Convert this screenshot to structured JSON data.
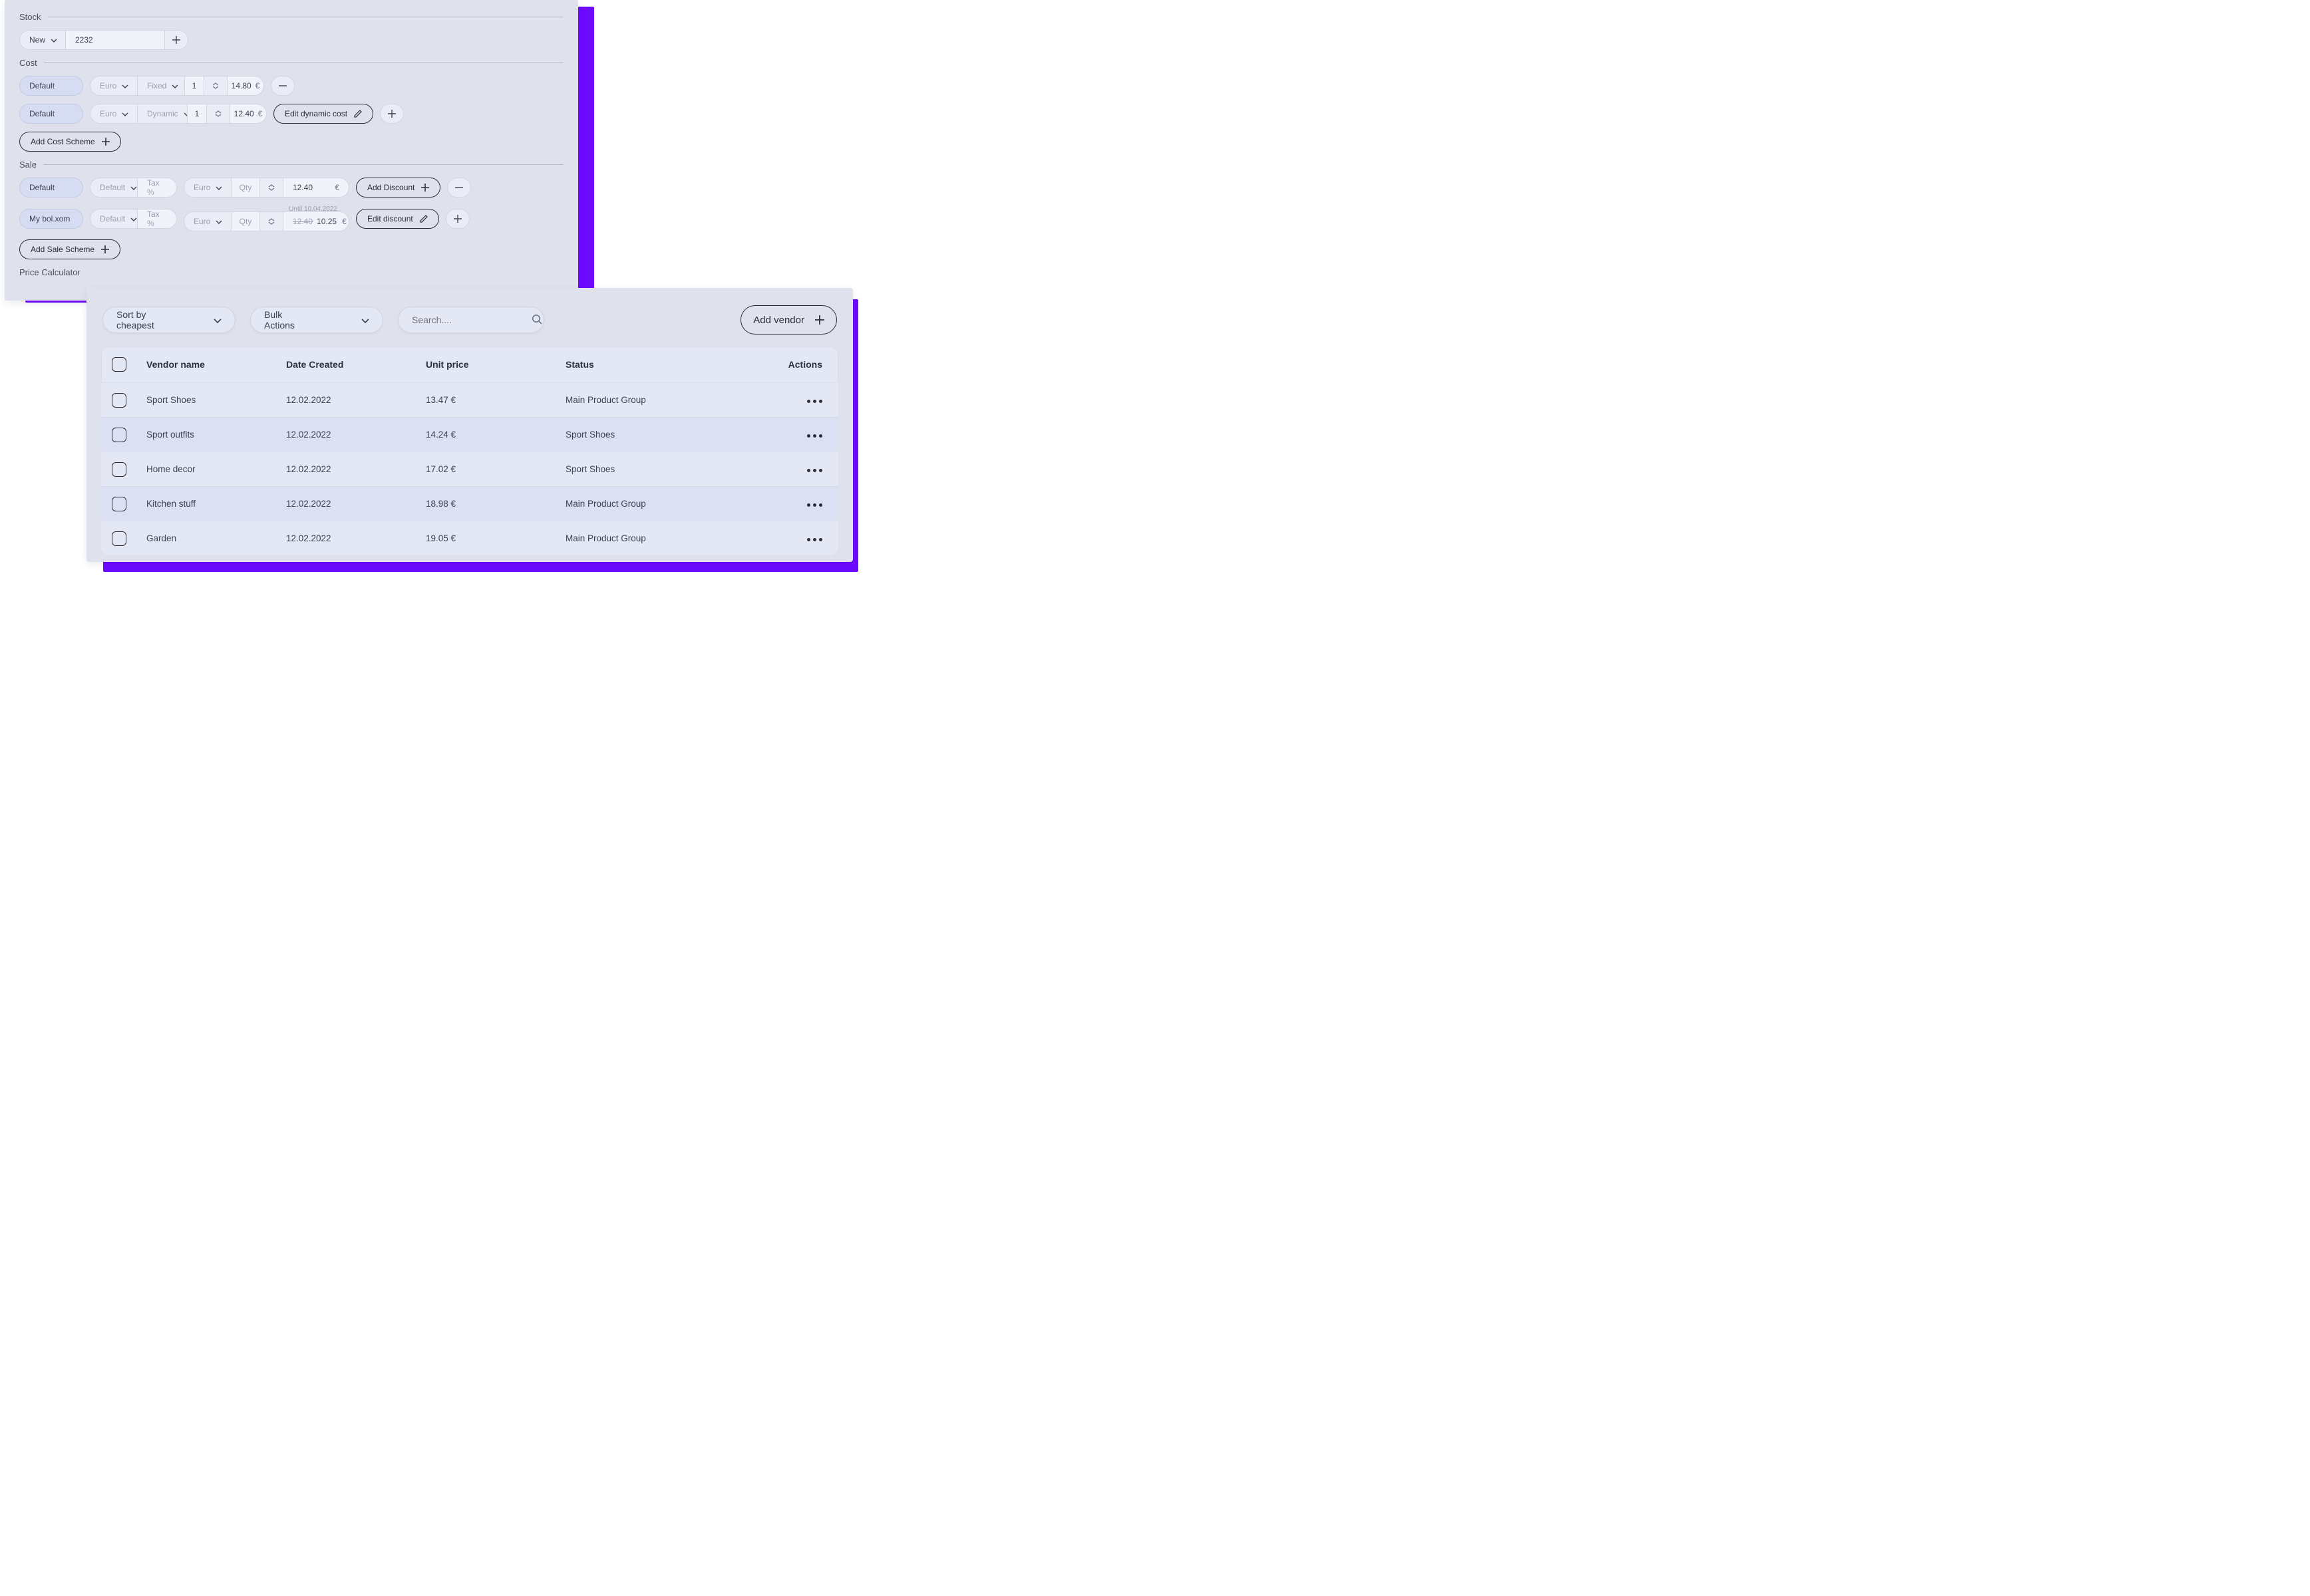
{
  "stock": {
    "heading": "Stock",
    "condition_select": "New",
    "quantity_value": "2232"
  },
  "cost": {
    "heading": "Cost",
    "rows": [
      {
        "scheme": "Default",
        "currency": "Euro",
        "mode": "Fixed",
        "qty": "1",
        "price": "14.80",
        "symbol": "€"
      },
      {
        "scheme": "Default",
        "currency": "Euro",
        "mode": "Dynamic",
        "qty": "1",
        "price": "12.40",
        "symbol": "€",
        "edit_label": "Edit dynamic cost"
      }
    ],
    "add_label": "Add Cost Scheme"
  },
  "sale": {
    "heading": "Sale",
    "rows": [
      {
        "scheme": "Default",
        "tax_group": "Default",
        "tax_label": "Tax %",
        "currency": "Euro",
        "qty_label": "Qty",
        "price": "12.40",
        "symbol": "€",
        "action_label": "Add Discount"
      },
      {
        "scheme": "My bol.xom",
        "tax_group": "Default",
        "tax_label": "Tax %",
        "currency": "Euro",
        "qty_label": "Qty",
        "price_strike": "12.40",
        "price": "10.25",
        "symbol": "€",
        "note": "Until 10.04.2022",
        "action_label": "Edit discount"
      }
    ],
    "add_label": "Add Sale Scheme"
  },
  "calculator": {
    "heading": "Price Calculator"
  },
  "toolbar": {
    "sort_label": "Sort by cheapest",
    "bulk_label": "Bulk Actions",
    "search_placeholder": "Search....",
    "add_vendor_label": "Add vendor"
  },
  "table": {
    "headers": {
      "vendor": "Vendor name",
      "date": "Date Created",
      "price": "Unit price",
      "status": "Status",
      "actions": "Actions"
    },
    "rows": [
      {
        "vendor": "Sport Shoes",
        "date": "12.02.2022",
        "price": "13.47 €",
        "status": "Main Product Group"
      },
      {
        "vendor": "Sport outfits",
        "date": "12.02.2022",
        "price": "14.24 €",
        "status": "Sport Shoes"
      },
      {
        "vendor": "Home decor",
        "date": "12.02.2022",
        "price": "17.02 €",
        "status": "Sport Shoes"
      },
      {
        "vendor": "Kitchen stuff",
        "date": "12.02.2022",
        "price": "18.98 €",
        "status": "Main Product Group"
      },
      {
        "vendor": "Garden",
        "date": "12.02.2022",
        "price": "19.05 €",
        "status": "Main Product Group"
      }
    ]
  }
}
